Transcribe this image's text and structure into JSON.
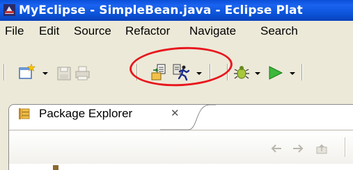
{
  "window": {
    "title": "MyEclipse - SimpleBean.java - Eclipse Plat",
    "title_bar_color": "#0b4fd8"
  },
  "menu": {
    "items": [
      {
        "label": "File"
      },
      {
        "label": "Edit"
      },
      {
        "label": "Source"
      },
      {
        "label": "Refactor"
      },
      {
        "label": "Navigate"
      },
      {
        "label": "Search"
      }
    ]
  },
  "toolbar": {
    "buttons": [
      {
        "icon": "new-wizard-icon",
        "has_dropdown": true
      },
      {
        "icon": "save-icon",
        "enabled": false
      },
      {
        "icon": "print-icon",
        "enabled": false
      },
      {
        "icon": "deploy-project-icon"
      },
      {
        "icon": "run-server-icon",
        "has_dropdown": true
      },
      {
        "icon": "debug-icon",
        "has_dropdown": true
      },
      {
        "icon": "run-icon",
        "has_dropdown": true
      }
    ],
    "highlight_color": "#e8171e"
  },
  "view": {
    "tab_label": "Package Explorer",
    "tab_icon": "package-explorer-icon",
    "close_icon": "close-icon",
    "nav": [
      {
        "icon": "back-arrow-icon",
        "enabled": false
      },
      {
        "icon": "forward-arrow-icon",
        "enabled": false
      },
      {
        "icon": "up-folder-icon",
        "enabled": false
      }
    ]
  }
}
